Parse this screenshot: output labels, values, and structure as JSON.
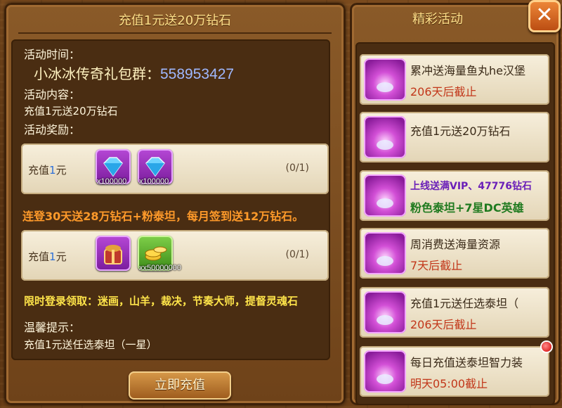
{
  "left": {
    "title": "充值1元送20万钻石",
    "time_label": "活动时间：",
    "promo_text": "小冰冰传奇礼包群：",
    "promo_number": "558953427",
    "content_label": "活动内容：",
    "content_text": "充值1元送20万钻石",
    "reward_label": "活动奖励：",
    "reward_cards": [
      {
        "label_prefix": "充值",
        "label_amount": "1",
        "label_suffix": "元",
        "progress": "(0/1)",
        "items": [
          {
            "icon": "diamond-icon",
            "qty": "x100000"
          },
          {
            "icon": "diamond-icon",
            "qty": "x100000"
          }
        ]
      },
      {
        "label_prefix": "充值",
        "label_amount": "1",
        "label_suffix": "元",
        "progress": "(0/1)",
        "items": [
          {
            "icon": "gift-bag-icon",
            "qty": ""
          },
          {
            "icon": "gold-coins-icon",
            "qty": "xx50000000"
          }
        ]
      }
    ],
    "orange_notice": "连登30天送28万钻石+粉泰坦，每月签到送12万钻石。",
    "yellow_notice": "限时登录领取：迷画，山羊，裁决，节奏大师，提督灵魂石",
    "tip_label": "温馨提示：",
    "tip_text": "充值1元送任选泰坦（一星）",
    "charge_button": "立即充值"
  },
  "right": {
    "title": "精彩活动",
    "close_symbol": "✕",
    "activities": [
      {
        "line1": "累冲送海量鱼丸he汉堡",
        "line2": "206天后截止"
      },
      {
        "line1": "充值1元送20万钻石",
        "line2": ""
      },
      {
        "line1": "上线送满VIP、47776钻石",
        "line2": "粉色泰坦+7星DC英雄"
      },
      {
        "line1": "周消费送海量资源",
        "line2": "7天后截止"
      },
      {
        "line1": "充值1元送任选泰坦（",
        "line2": "206天后截止"
      },
      {
        "line1": "每日充值送泰坦智力装",
        "line2": "明天05:00截止"
      }
    ]
  },
  "colors": {
    "wood": "#7a4a1d",
    "title": "#ffe08a",
    "orange_text": "#ff9a2a",
    "yellow_text": "#ffe54a",
    "deadline_red": "#c2371a",
    "accent_blue": "#2c6fd8"
  }
}
